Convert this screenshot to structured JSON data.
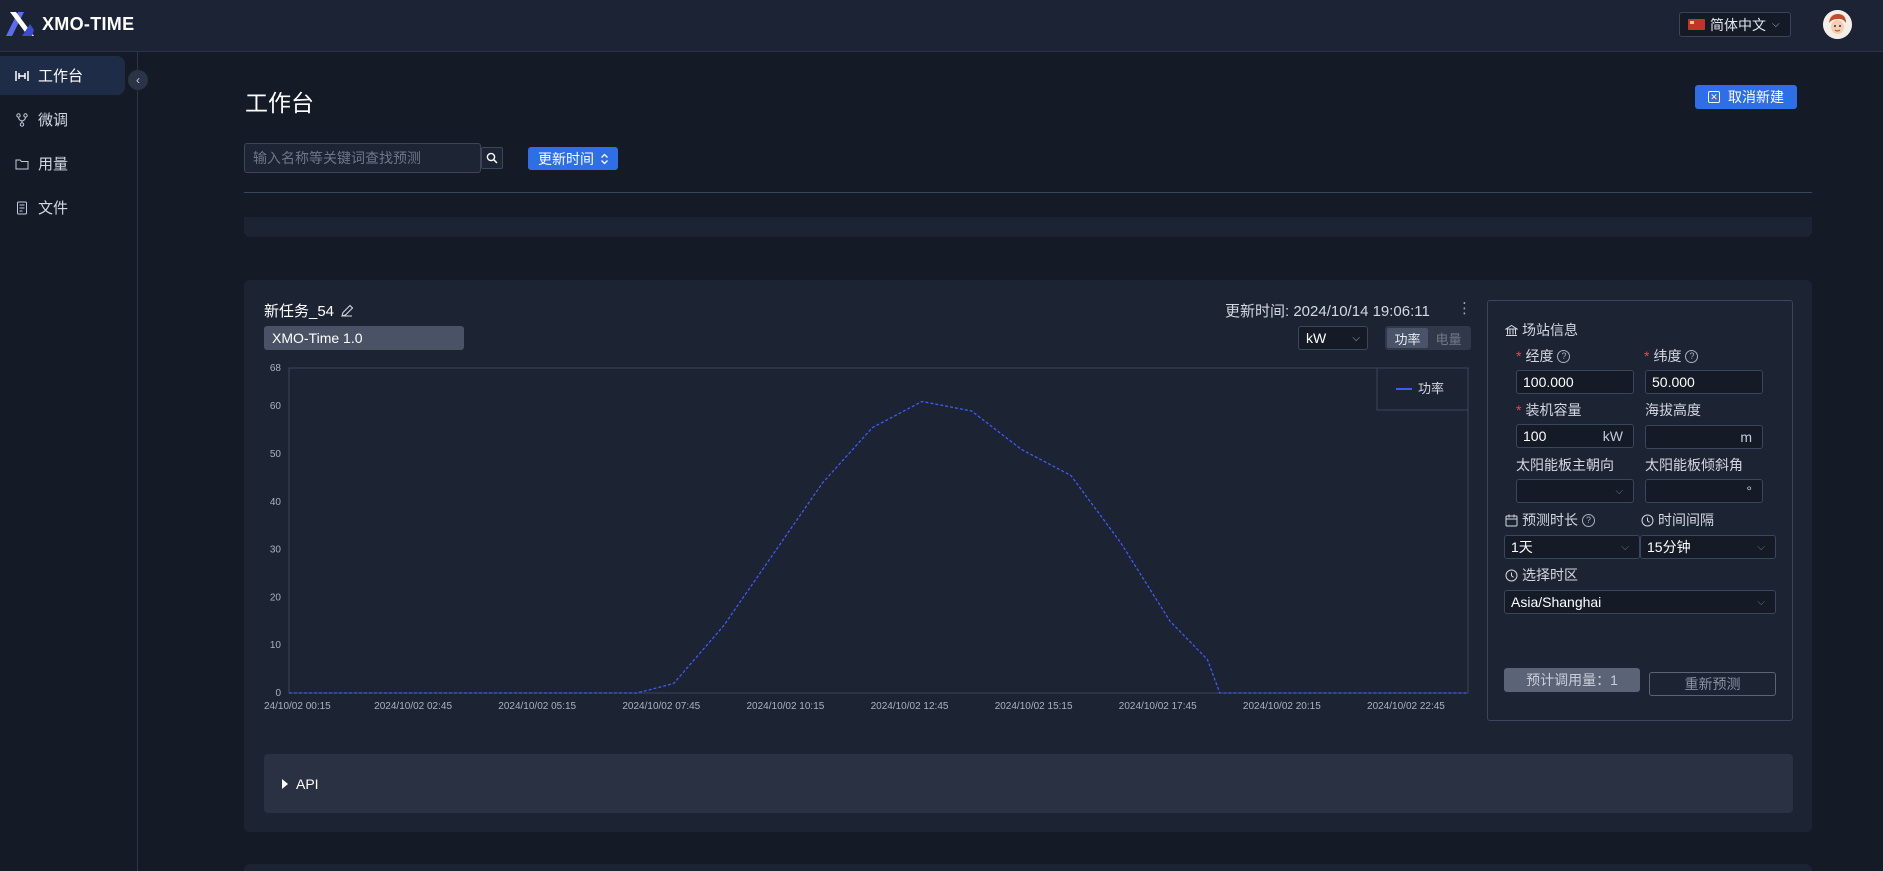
{
  "app": {
    "name": "XMO-TIME"
  },
  "header": {
    "language": "简体中文"
  },
  "sidebar": {
    "items": [
      {
        "label": "工作台",
        "icon": "workbench-icon",
        "active": true
      },
      {
        "label": "微调",
        "icon": "fork-icon",
        "active": false
      },
      {
        "label": "用量",
        "icon": "folder-icon",
        "active": false
      },
      {
        "label": "文件",
        "icon": "document-icon",
        "active": false
      }
    ]
  },
  "page": {
    "title": "工作台",
    "cancel_new_label": "取消新建",
    "search_placeholder": "输入名称等关键词查找预测",
    "sort_label": "更新时间"
  },
  "task": {
    "name": "新任务_54",
    "model": "XMO-Time 1.0",
    "update_time": "更新时间: 2024/10/14 19:06:11",
    "unit": "kW",
    "toggle": {
      "power": "功率",
      "energy": "电量",
      "selected": "功率"
    }
  },
  "chart_data": {
    "type": "line",
    "legend_position": "top-right",
    "ylim": [
      0,
      68
    ],
    "yticks": [
      0,
      10,
      20,
      30,
      40,
      50,
      60,
      68
    ],
    "xtick_labels": [
      "24/10/02 00:15",
      "2024/10/02 02:45",
      "2024/10/02 05:15",
      "2024/10/02 07:45",
      "2024/10/02 10:15",
      "2024/10/02 12:45",
      "2024/10/02 15:15",
      "2024/10/02 17:45",
      "2024/10/02 20:15",
      "2024/10/02 22:45"
    ],
    "series": [
      {
        "name": "功率",
        "color": "#3d5bf5",
        "dashed": true,
        "points": [
          [
            "00:15",
            0
          ],
          [
            "07:15",
            0
          ],
          [
            "07:45",
            1.3
          ],
          [
            "08:00",
            2
          ],
          [
            "09:00",
            14
          ],
          [
            "10:00",
            29
          ],
          [
            "11:00",
            44
          ],
          [
            "12:00",
            55.5
          ],
          [
            "13:00",
            61
          ],
          [
            "14:00",
            59
          ],
          [
            "15:00",
            51
          ],
          [
            "16:00",
            45.5
          ],
          [
            "17:00",
            31.5
          ],
          [
            "18:00",
            15
          ],
          [
            "18:45",
            7
          ],
          [
            "19:00",
            0
          ],
          [
            "24:00",
            0
          ]
        ]
      }
    ]
  },
  "station": {
    "title": "场站信息",
    "longitude_label": "经度",
    "longitude_value": "100.000",
    "latitude_label": "纬度",
    "latitude_value": "50.000",
    "capacity_label": "装机容量",
    "capacity_value": "100",
    "capacity_unit": "kW",
    "altitude_label": "海拔高度",
    "altitude_value": "",
    "altitude_unit": "m",
    "orientation_label": "太阳能板主朝向",
    "orientation_value": "",
    "tilt_label": "太阳能板倾斜角",
    "tilt_value": "",
    "tilt_unit": "°",
    "horizon_label": "预测时长",
    "horizon_value": "1天",
    "interval_label": "时间间隔",
    "interval_value": "15分钟",
    "timezone_label": "选择时区",
    "timezone_value": "Asia/Shanghai",
    "estimate_label": "预计调用量：1",
    "repredict_label": "重新预测"
  },
  "api": {
    "label": "API"
  }
}
